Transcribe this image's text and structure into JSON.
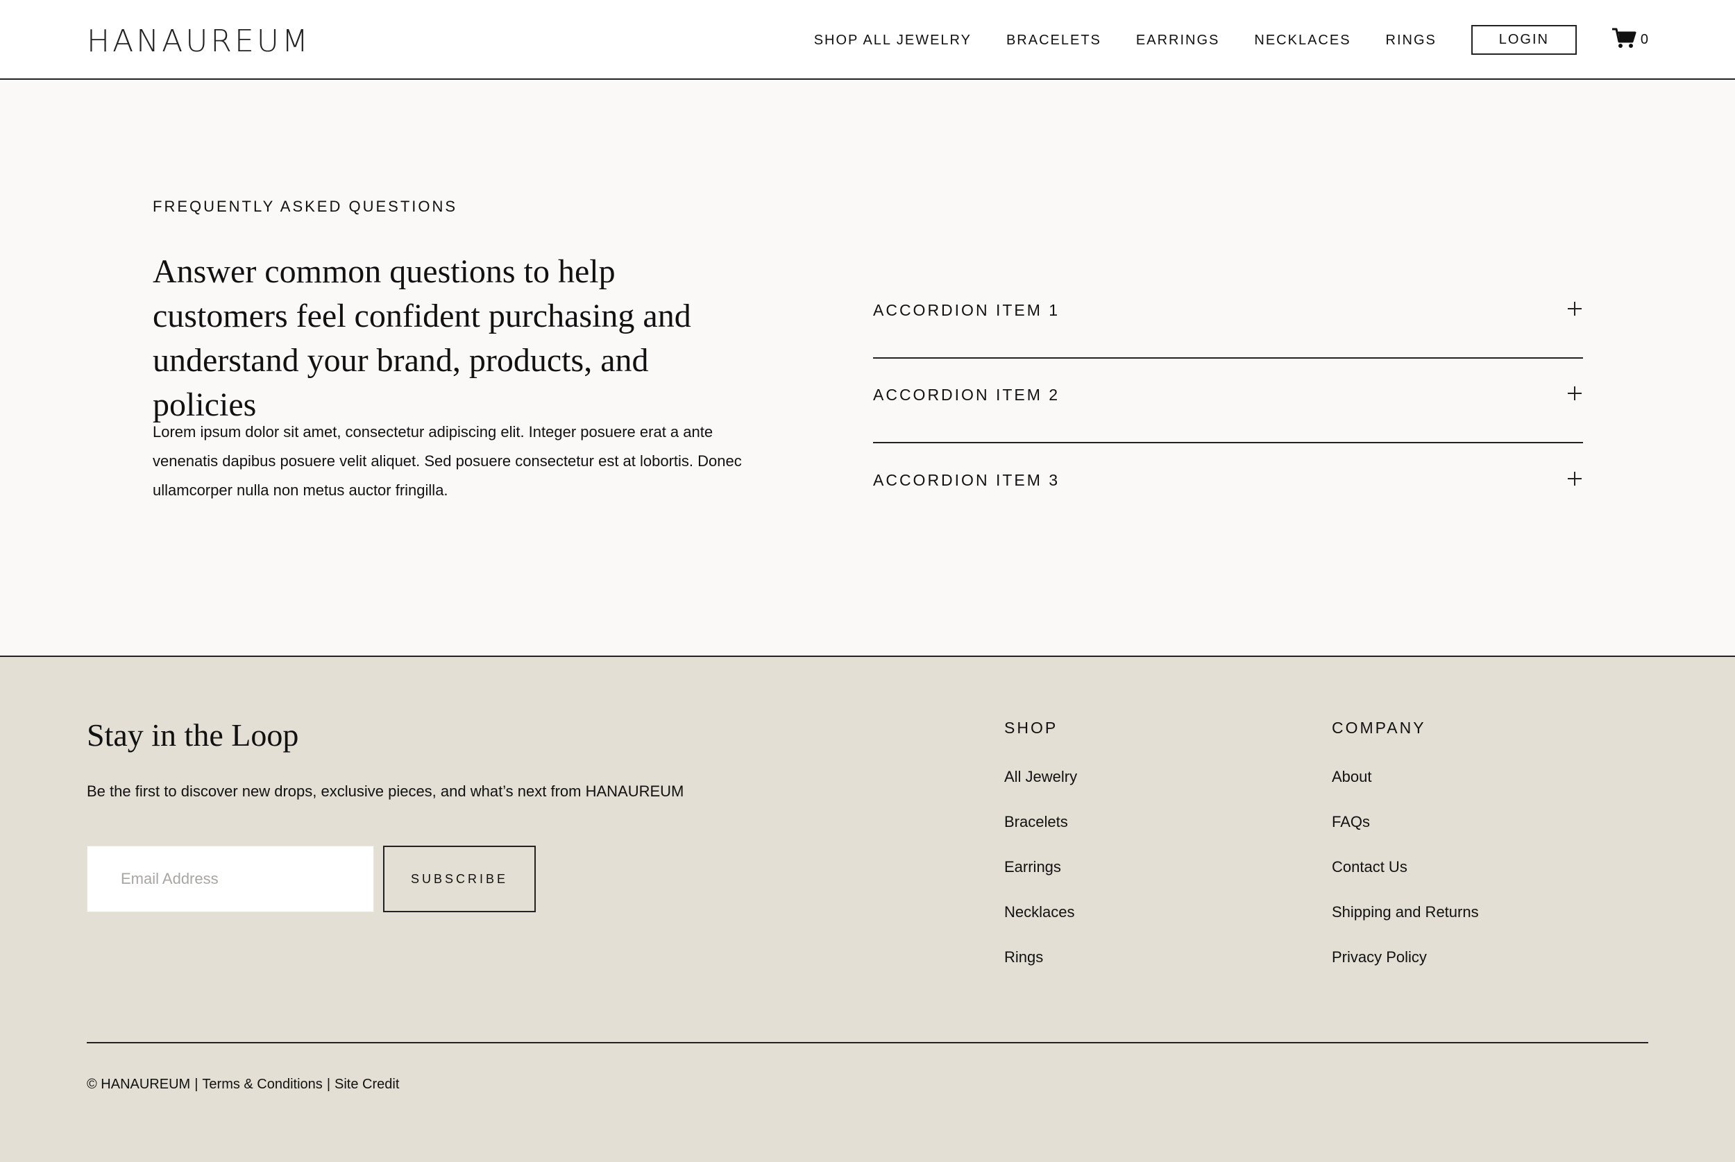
{
  "header": {
    "logo": "HANAUREUM",
    "nav": [
      "SHOP ALL JEWELRY",
      "BRACELETS",
      "EARRINGS",
      "NECKLACES",
      "RINGS"
    ],
    "login_label": "LOGIN",
    "cart_icon": "cart-icon",
    "cart_count": "0"
  },
  "faq": {
    "eyebrow": "FREQUENTLY ASKED QUESTIONS",
    "heading": "Answer common questions to help customers feel confident purchasing and understand your brand, products, and policies",
    "body": "Lorem ipsum dolor sit amet, consectetur adipiscing elit. Integer posuere erat a ante venenatis dapibus posuere velit aliquet. Sed posuere consectetur est at lobortis. Donec ullamcorper nulla non metus auctor fringilla.",
    "accordion": [
      {
        "label": "ACCORDION ITEM 1",
        "icon": "plus-icon"
      },
      {
        "label": "ACCORDION ITEM 2",
        "icon": "plus-icon"
      },
      {
        "label": "ACCORDION ITEM 3",
        "icon": "plus-icon"
      }
    ]
  },
  "footer": {
    "title": "Stay in the Loop",
    "subtitle": "Be the first to discover new drops, exclusive pieces, and what’s next from HANAUREUM",
    "email_placeholder": "Email Address",
    "subscribe_label": "SUBSCRIBE",
    "shop": {
      "title": "SHOP",
      "links": [
        "All Jewelry",
        "Bracelets",
        "Earrings",
        "Necklaces",
        "Rings"
      ]
    },
    "company": {
      "title": "COMPANY",
      "links": [
        "About",
        "FAQs",
        "Contact Us",
        "Shipping and Returns",
        "Privacy Policy"
      ]
    },
    "copyright": "© HANAUREUM",
    "separator": "|",
    "terms": "Terms & Conditions",
    "site_credit": "Site Credit"
  },
  "colors": {
    "header_bg": "#ffffff",
    "faq_bg": "#faf9f7",
    "footer_bg": "#e3dfd4",
    "rule": "#222222",
    "text": "#111111"
  }
}
